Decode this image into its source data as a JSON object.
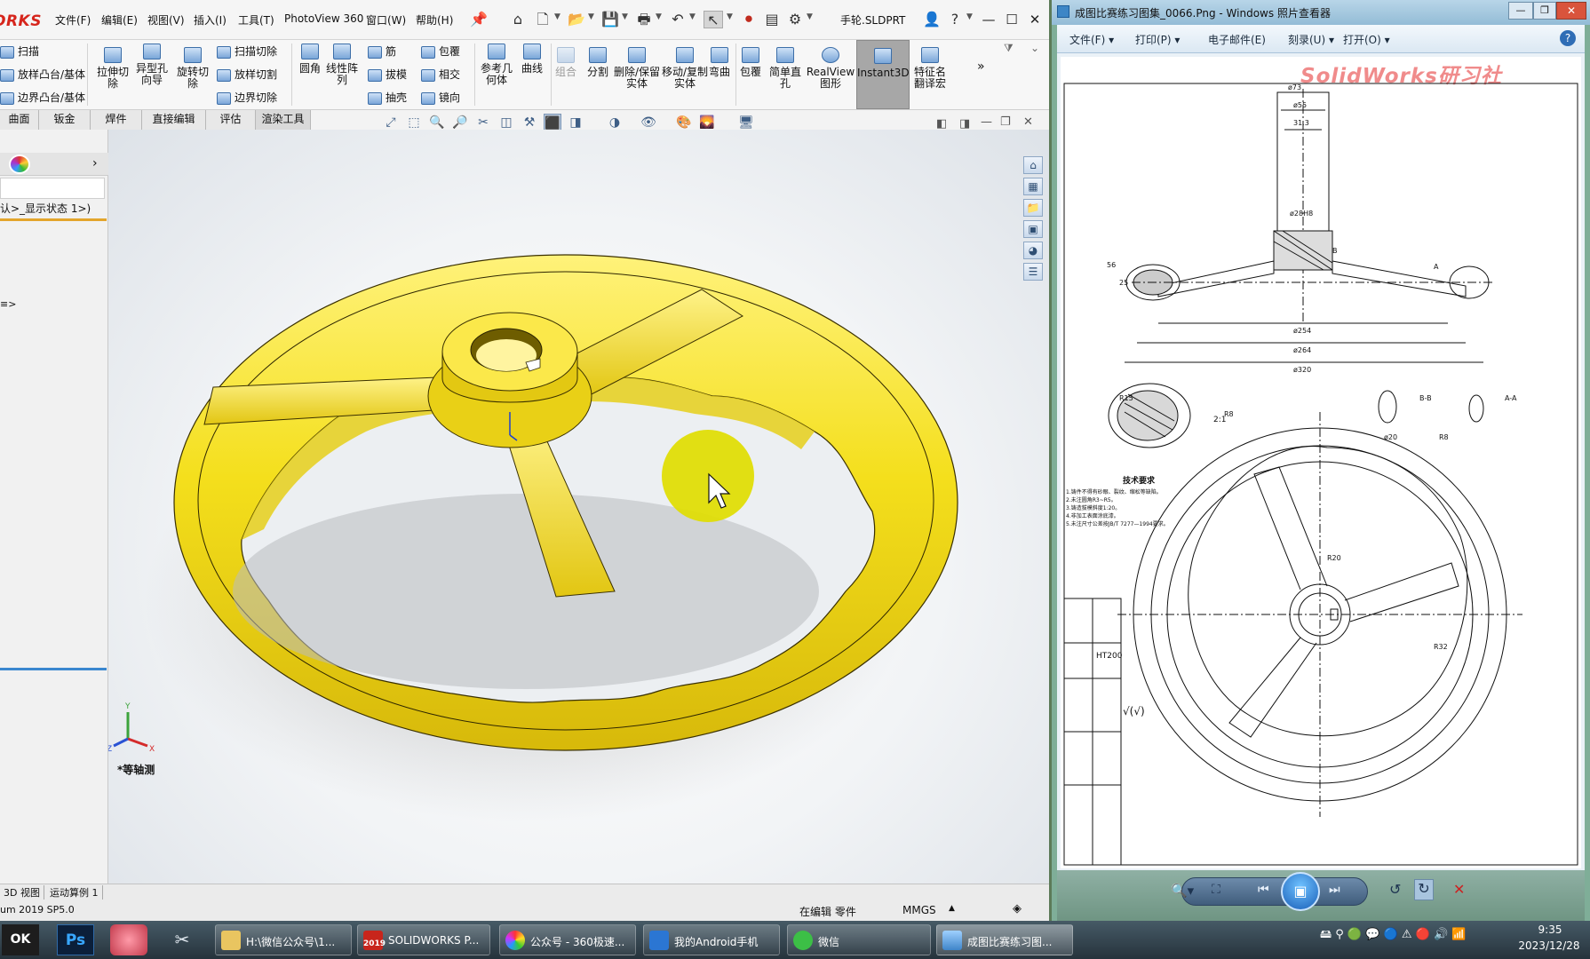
{
  "solidworks": {
    "logo": "ORKS",
    "menu": [
      "文件(F)",
      "编辑(E)",
      "视图(V)",
      "插入(I)",
      "工具(T)",
      "PhotoView 360",
      "窗口(W)",
      "帮助(H)"
    ],
    "document_title": "手轮.SLDPRT",
    "ribbon": {
      "col1": [
        "扫描",
        "放样凸台/基体",
        "边界凸台/基体"
      ],
      "big1": [
        {
          "label": "拉伸切除"
        },
        {
          "label": "异型孔向导"
        },
        {
          "label": "旋转切除"
        }
      ],
      "col2": [
        "扫描切除",
        "放样切割",
        "边界切除"
      ],
      "big2": [
        {
          "label": "圆角"
        },
        {
          "label": "线性阵列"
        }
      ],
      "col3": [
        "筋",
        "拔模",
        "抽壳"
      ],
      "col4": [
        "包覆",
        "相交",
        "镜向"
      ],
      "big3": [
        {
          "label": "参考几何体"
        },
        {
          "label": "曲线"
        },
        {
          "label": "组合"
        },
        {
          "label": "分割"
        },
        {
          "label": "删除/保留实体"
        },
        {
          "label": "移动/复制实体"
        },
        {
          "label": "弯曲"
        },
        {
          "label": "包覆"
        },
        {
          "label": "简单直孔"
        },
        {
          "label": "RealView图形"
        },
        {
          "label": "Instant3D"
        },
        {
          "label": "特征名翻译宏"
        }
      ]
    },
    "tabs": [
      "曲面",
      "钣金",
      "焊件",
      "直接编辑",
      "评估",
      "渲染工具"
    ],
    "tree_text": "认>_显示状态 1>)",
    "tree_marker": "≡>",
    "view_label": "*等轴测",
    "bottom_tabs": [
      "3D 视图",
      "运动算例 1"
    ],
    "status": {
      "version": "um 2019 SP5.0",
      "edit_state": "在编辑 零件",
      "units": "MMGS"
    },
    "colors": {
      "part": "#f2dd1a",
      "accent": "#d6251c"
    }
  },
  "photo_viewer": {
    "title": "成图比赛练习图集_0066.Png - Windows 照片查看器",
    "menu": [
      "文件(F)",
      "打印(P)",
      "电子邮件(E)",
      "刻录(U)",
      "打开(O)"
    ],
    "watermark": "SolidWorks研习社",
    "drawing_labels": {
      "dims": [
        "ø73",
        "ø55",
        "31.3",
        "ø28H8",
        "ø254",
        "ø264",
        "ø320",
        "56",
        "25",
        "R20",
        "R32",
        "R8",
        "R15",
        "2:1",
        "A-A",
        "B-B",
        "A",
        "B",
        "R8",
        "ø20"
      ],
      "tech_title": "技术要求",
      "tech_lines": [
        "1.铸件不得有砂眼、裂纹、缩松等缺陷。",
        "2.未注圆角R3~R5。",
        "3.铸造拔模斜度1:20。",
        "4.非加工表面涂底漆。",
        "5.未注尺寸公差按JB/T 7277—1994要求。"
      ],
      "material": "HT200",
      "roughness": "√(√)"
    }
  },
  "taskbar": {
    "items": [
      {
        "label": "H:\\微信公众号\\1..."
      },
      {
        "label": "SOLIDWORKS P..."
      },
      {
        "label": "公众号 - 360极速..."
      },
      {
        "label": "我的Android手机"
      },
      {
        "label": "微信"
      },
      {
        "label": "成图比赛练习图..."
      }
    ],
    "pinned": [
      "OK",
      "Ps"
    ],
    "sw_badge": "2019",
    "time": "9:35",
    "date": "2023/12/28"
  }
}
